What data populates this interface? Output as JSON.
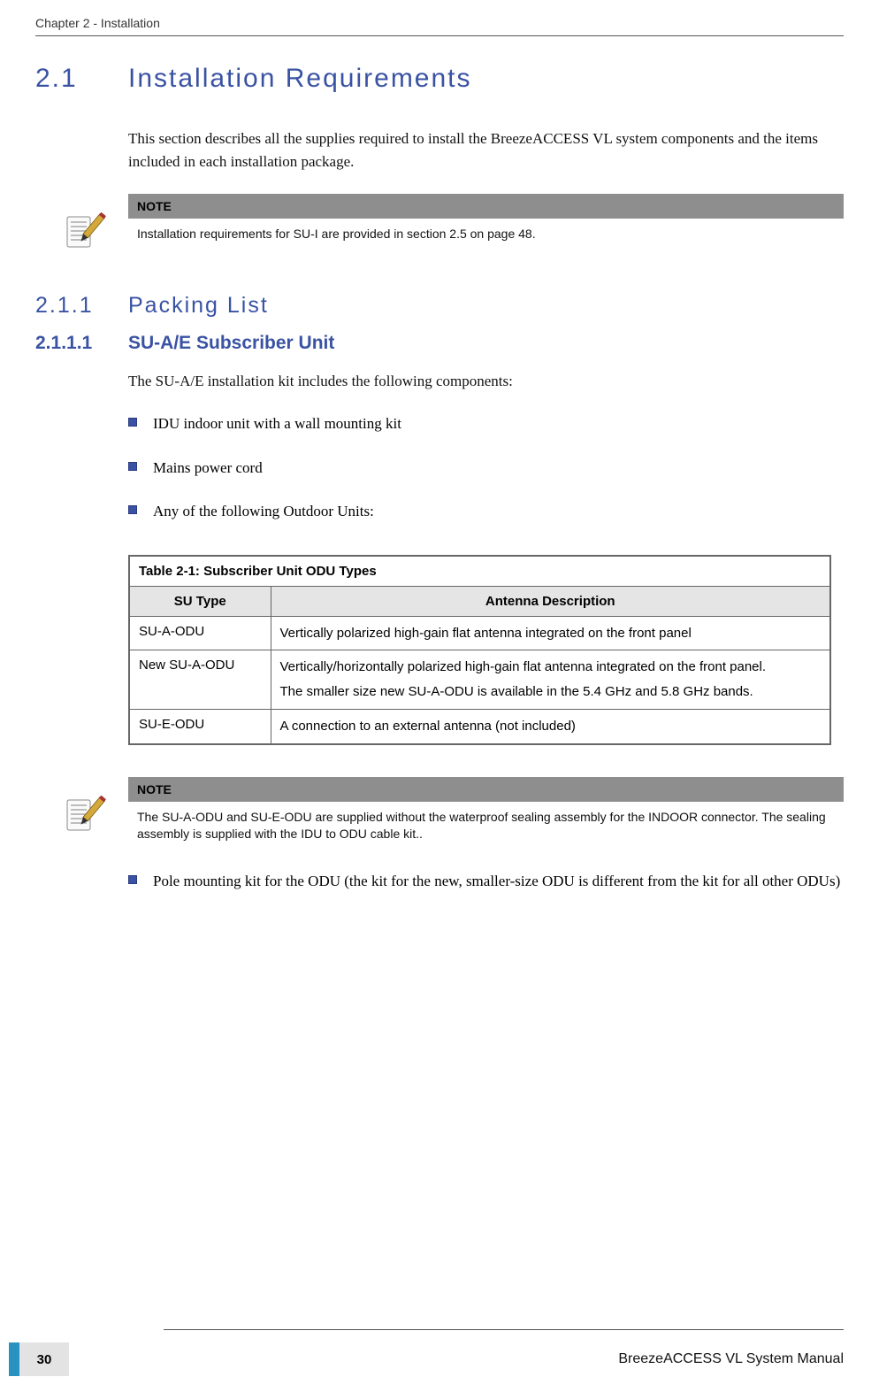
{
  "header": {
    "chapter": "Chapter 2 - Installation"
  },
  "section": {
    "num": "2.1",
    "title": "Installation Requirements",
    "intro": "This section describes all the supplies required to install the BreezeACCESS VL system components and the items included in each installation package."
  },
  "note1": {
    "label": "NOTE",
    "text": "Installation requirements for SU-I are provided in section 2.5 on page 48."
  },
  "subsection": {
    "num": "2.1.1",
    "title": "Packing List"
  },
  "subsub": {
    "num": "2.1.1.1",
    "title": "SU-A/E Subscriber Unit",
    "intro": "The SU-A/E installation kit includes the following components:"
  },
  "bullets1": [
    "IDU indoor unit with a wall mounting kit",
    "Mains power cord",
    "Any of the following Outdoor Units:"
  ],
  "table": {
    "caption": "Table 2-1: Subscriber Unit ODU Types",
    "headers": [
      "SU Type",
      "Antenna Description"
    ],
    "rows": [
      {
        "type": "SU-A-ODU",
        "desc": [
          "Vertically polarized high-gain flat antenna integrated on the front panel"
        ]
      },
      {
        "type": "New SU-A-ODU",
        "desc": [
          "Vertically/horizontally polarized high-gain flat antenna integrated on the front panel.",
          "The smaller size new SU-A-ODU is available in the 5.4 GHz and 5.8 GHz bands."
        ]
      },
      {
        "type": "SU-E-ODU",
        "desc": [
          "A connection to an external antenna (not included)"
        ]
      }
    ]
  },
  "note2": {
    "label": "NOTE",
    "text": "The SU-A-ODU and SU-E-ODU are supplied without the waterproof sealing assembly for the INDOOR connector. The sealing assembly is supplied with the IDU to ODU cable kit.."
  },
  "bullets2": [
    "Pole mounting kit for the ODU (the kit for the new, smaller-size ODU is different from the kit for all other ODUs)"
  ],
  "footer": {
    "page": "30",
    "manual": "BreezeACCESS VL System Manual"
  },
  "icons": {
    "note": "note-pencil-icon"
  }
}
